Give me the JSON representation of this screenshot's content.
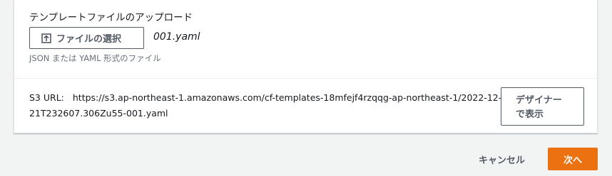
{
  "upload": {
    "label": "テンプレートファイルのアップロード",
    "button_label": "ファイルの選択",
    "button_icon": "upload-icon",
    "file_name": "001.yaml",
    "hint": "JSON または YAML 形式のファイル"
  },
  "s3": {
    "key_label": "S3 URL:",
    "url": "https://s3.ap-northeast-1.amazonaws.com/cf-templates-18mfejf4rzqqg-ap-northeast-1/2022-12-21T232607.306Zu55-001.yaml",
    "designer_button_label": "デザイナーで表示"
  },
  "footer": {
    "cancel_label": "キャンセル",
    "next_label": "次へ"
  },
  "colors": {
    "primary": "#ec7211",
    "page_background": "#f2f3f3",
    "border": "#545b64"
  }
}
